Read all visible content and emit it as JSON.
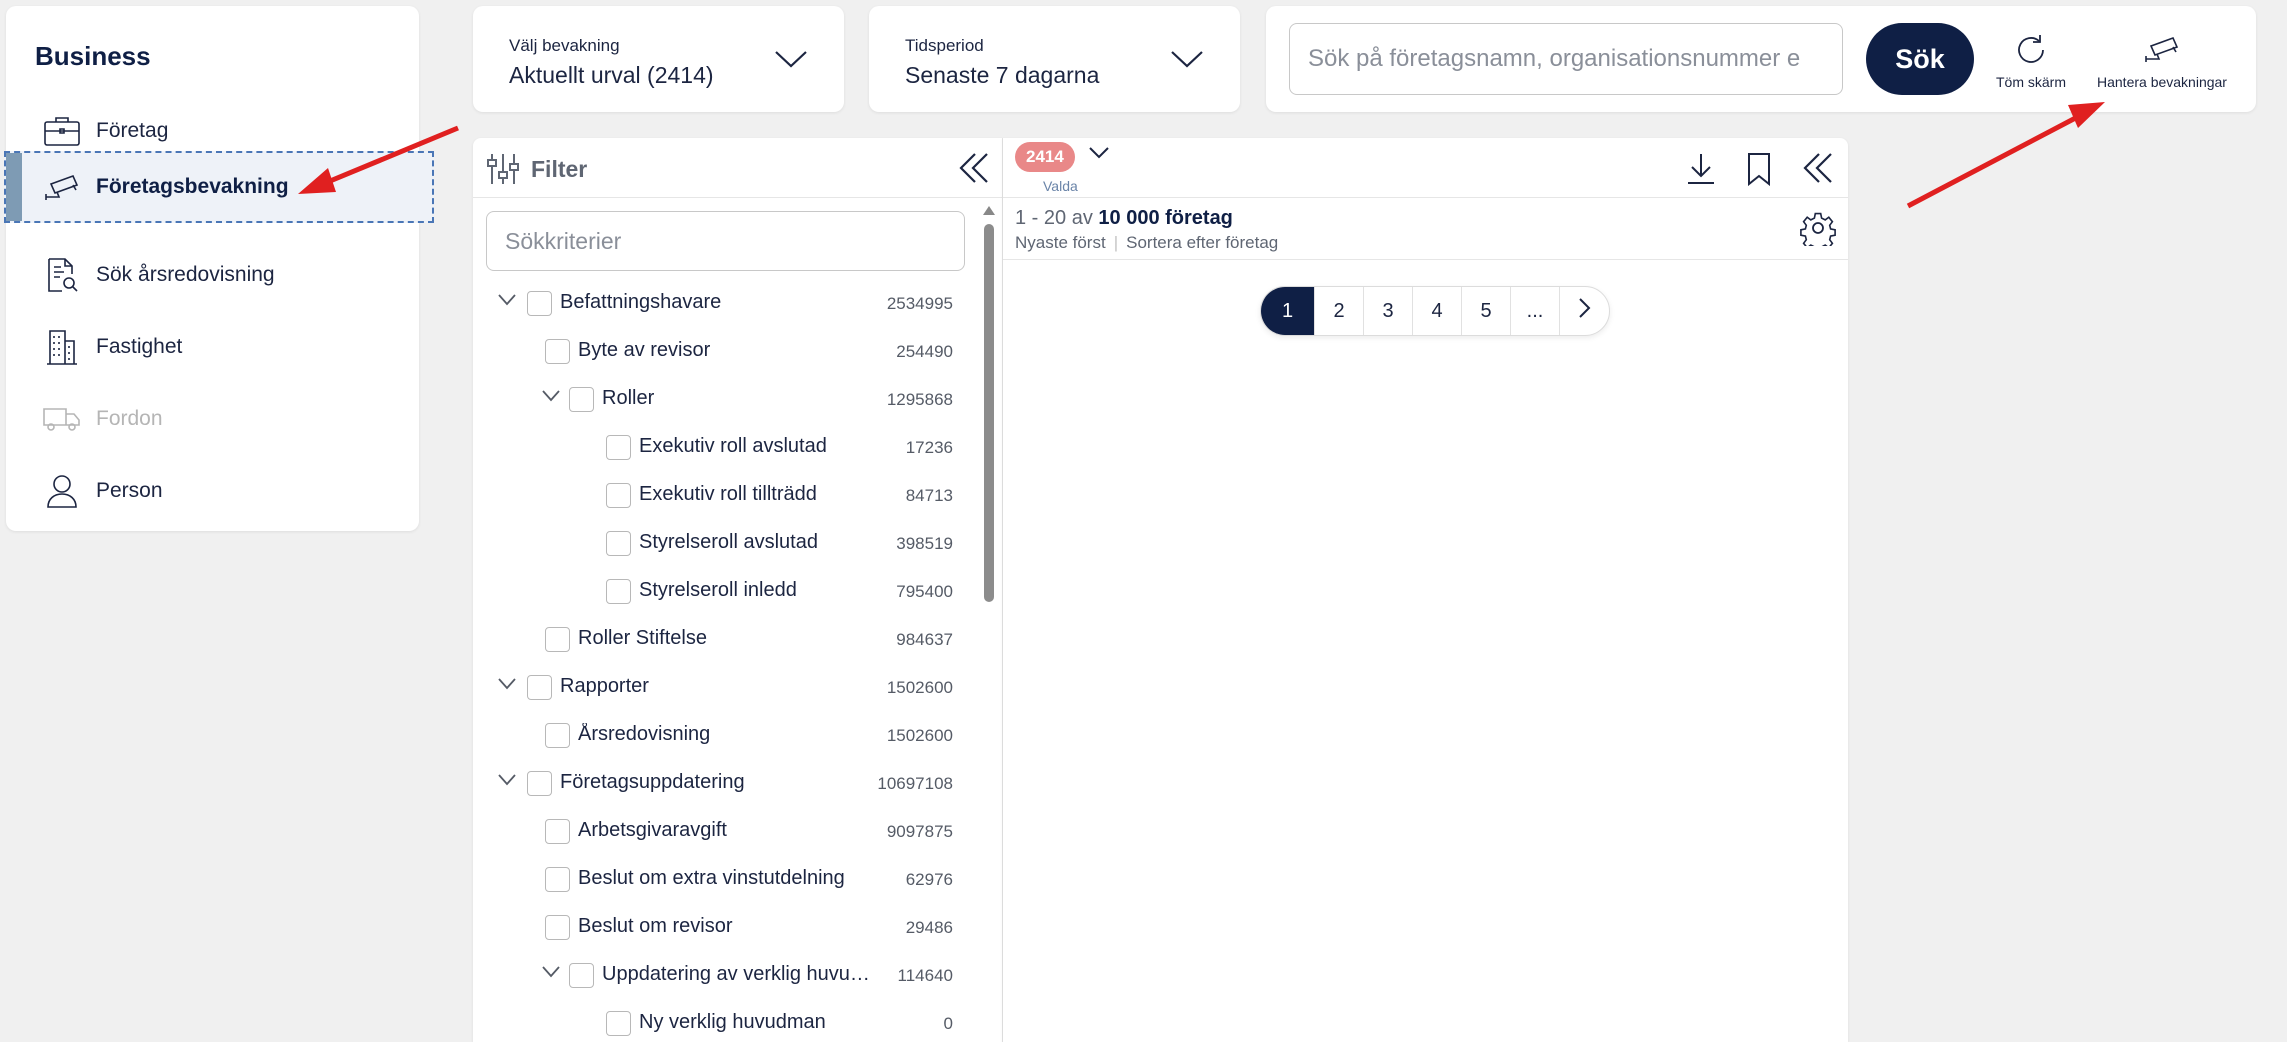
{
  "sidebar": {
    "brand": "Business",
    "items": [
      {
        "label": "Företag",
        "icon": "briefcase-icon",
        "state": "normal"
      },
      {
        "label": "Företagsbevakning",
        "icon": "surveillance-camera-icon",
        "state": "active"
      },
      {
        "label": "Sök årsredovisning",
        "icon": "document-search-icon",
        "state": "normal"
      },
      {
        "label": "Fastighet",
        "icon": "building-icon",
        "state": "normal"
      },
      {
        "label": "Fordon",
        "icon": "truck-icon",
        "state": "disabled"
      },
      {
        "label": "Person",
        "icon": "person-icon",
        "state": "normal"
      }
    ]
  },
  "watch_select": {
    "caption": "Välj bevakning",
    "value": "Aktuellt urval (2414)"
  },
  "period_select": {
    "caption": "Tidsperiod",
    "value": "Senaste 7 dagarna"
  },
  "search": {
    "placeholder": "Sök på företagsnamn, organisationsnummer e",
    "button_label": "Sök",
    "clear_label": "Töm skärm",
    "manage_label": "Hantera bevakningar"
  },
  "filter": {
    "title": "Filter",
    "criteria_placeholder": "Sökkriterier",
    "tree": [
      {
        "label": "Befattningshavare",
        "count": "2534995",
        "level": 0,
        "expanded": true
      },
      {
        "label": "Byte av revisor",
        "count": "254490",
        "level": 1,
        "expanded": null
      },
      {
        "label": "Roller",
        "count": "1295868",
        "level": 1,
        "expanded": true
      },
      {
        "label": "Exekutiv roll avslutad",
        "count": "17236",
        "level": 2,
        "expanded": null
      },
      {
        "label": "Exekutiv roll tillträdd",
        "count": "84713",
        "level": 2,
        "expanded": null
      },
      {
        "label": "Styrelseroll avslutad",
        "count": "398519",
        "level": 2,
        "expanded": null
      },
      {
        "label": "Styrelseroll inledd",
        "count": "795400",
        "level": 2,
        "expanded": null
      },
      {
        "label": "Roller Stiftelse",
        "count": "984637",
        "level": 1,
        "expanded": null
      },
      {
        "label": "Rapporter",
        "count": "1502600",
        "level": 0,
        "expanded": true
      },
      {
        "label": "Årsredovisning",
        "count": "1502600",
        "level": 1,
        "expanded": null
      },
      {
        "label": "Företagsuppdatering",
        "count": "10697108",
        "level": 0,
        "expanded": true
      },
      {
        "label": "Arbetsgivaravgift",
        "count": "9097875",
        "level": 1,
        "expanded": null
      },
      {
        "label": "Beslut om extra vinstutdelning",
        "count": "62976",
        "level": 1,
        "expanded": null
      },
      {
        "label": "Beslut om revisor",
        "count": "29486",
        "level": 1,
        "expanded": null
      },
      {
        "label": "Uppdatering av verklig huvudman",
        "count": "114640",
        "level": 1,
        "expanded": true
      },
      {
        "label": "Ny verklig huvudman",
        "count": "0",
        "level": 2,
        "expanded": null
      }
    ]
  },
  "results": {
    "selected_count": "2414",
    "selected_caption": "Valda",
    "range_text": "1 - 20 av ",
    "total_text": "10 000 företag",
    "sort_newest": "Nyaste först",
    "sort_by": "Sortera efter företag",
    "pages": [
      "1",
      "2",
      "3",
      "4",
      "5",
      "..."
    ],
    "current_page": "1"
  }
}
